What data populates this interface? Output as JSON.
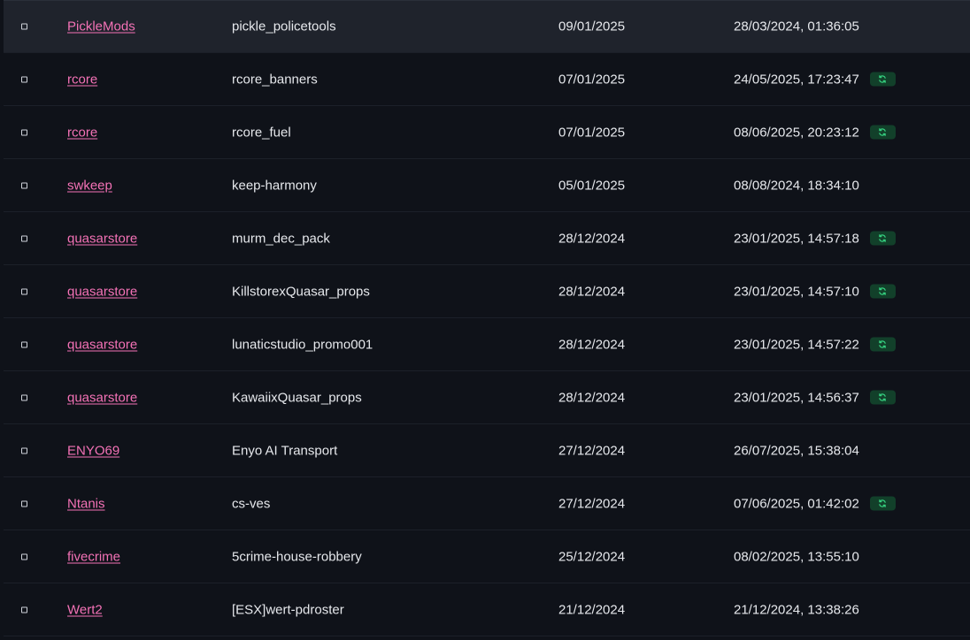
{
  "rows": [
    {
      "author": "PickleMods",
      "resource": "pickle_policetools",
      "released": "09/01/2025",
      "updated": "28/03/2024, 01:36:05",
      "badge": false,
      "highlight": true
    },
    {
      "author": "rcore",
      "resource": "rcore_banners",
      "released": "07/01/2025",
      "updated": "24/05/2025, 17:23:47",
      "badge": true
    },
    {
      "author": "rcore",
      "resource": "rcore_fuel",
      "released": "07/01/2025",
      "updated": "08/06/2025, 20:23:12",
      "badge": true
    },
    {
      "author": "swkeep",
      "resource": "keep-harmony",
      "released": "05/01/2025",
      "updated": "08/08/2024, 18:34:10",
      "badge": false
    },
    {
      "author": "quasarstore",
      "resource": "murm_dec_pack",
      "released": "28/12/2024",
      "updated": "23/01/2025, 14:57:18",
      "badge": true
    },
    {
      "author": "quasarstore",
      "resource": "KillstorexQuasar_props",
      "released": "28/12/2024",
      "updated": "23/01/2025, 14:57:10",
      "badge": true
    },
    {
      "author": "quasarstore",
      "resource": "lunaticstudio_promo001",
      "released": "28/12/2024",
      "updated": "23/01/2025, 14:57:22",
      "badge": true
    },
    {
      "author": "quasarstore",
      "resource": "KawaiixQuasar_props",
      "released": "28/12/2024",
      "updated": "23/01/2025, 14:56:37",
      "badge": true
    },
    {
      "author": "ENYO69",
      "resource": "Enyo AI Transport",
      "released": "27/12/2024",
      "updated": "26/07/2025, 15:38:04",
      "badge": false
    },
    {
      "author": "Ntanis",
      "resource": "cs-ves",
      "released": "27/12/2024",
      "updated": "07/06/2025, 01:42:02",
      "badge": true
    },
    {
      "author": "fivecrime",
      "resource": "5crime-house-robbery",
      "released": "25/12/2024",
      "updated": "08/02/2025, 13:55:10",
      "badge": false
    },
    {
      "author": "Wert2",
      "resource": "[ESX]wert-pdroster",
      "released": "21/12/2024",
      "updated": "21/12/2024, 13:38:26",
      "badge": false
    }
  ],
  "icons": {
    "checkbox": "checkbox-icon",
    "badge": "refresh-icon"
  },
  "colors": {
    "background": "#0f1219",
    "highlight_row": "#1f232c",
    "author_link": "#f472b6",
    "badge_bg": "#12402a",
    "badge_fg": "#35d07f",
    "text": "#e6e8ec"
  }
}
